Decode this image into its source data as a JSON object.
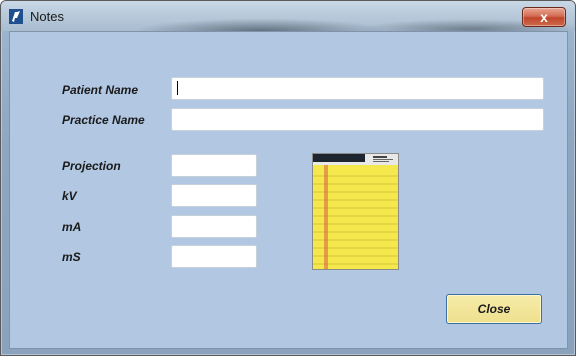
{
  "window": {
    "title": "Notes",
    "close_glyph": "x"
  },
  "icons": {
    "app": "notes-app-icon",
    "notepad": "yellow-notepad-icon",
    "close": "close-icon"
  },
  "form": {
    "patient_name_label": "Patient Name",
    "patient_name_value": "",
    "practice_name_label": "Practice Name",
    "practice_name_value": "",
    "projection_label": "Projection",
    "projection_value": "",
    "kv_label": "kV",
    "kv_value": "",
    "ma_label": "mA",
    "ma_value": "",
    "ms_label": "mS",
    "ms_value": ""
  },
  "buttons": {
    "close_label": "Close"
  },
  "colors": {
    "client_background": "#b1c7e2",
    "close_button": "#efe08d",
    "notepad_yellow": "#f2e64a",
    "titlebar_close": "#c0452b"
  }
}
